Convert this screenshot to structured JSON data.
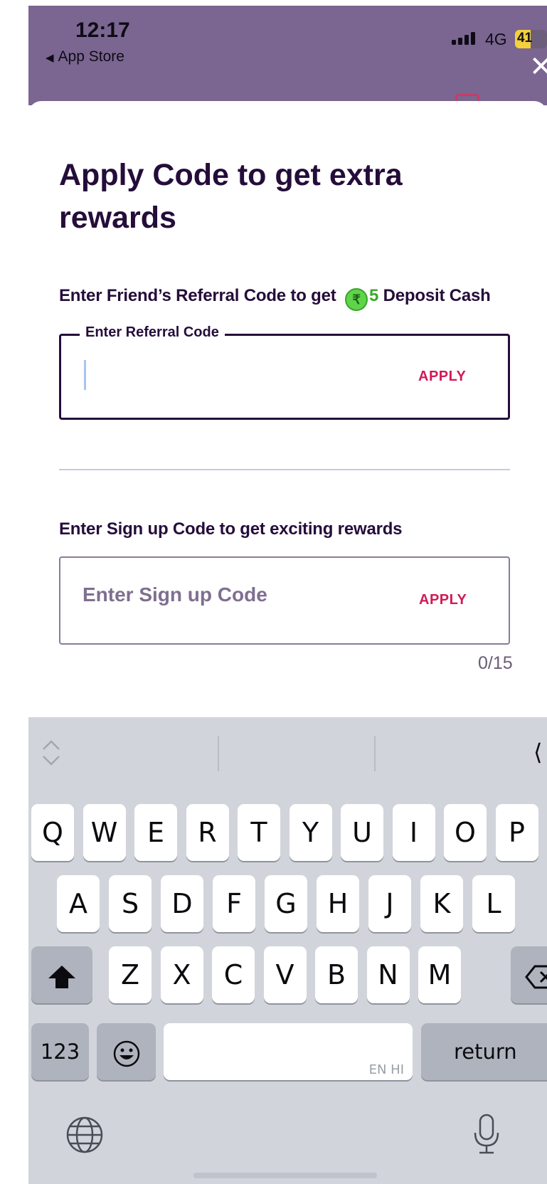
{
  "status_bar": {
    "time": "12:17",
    "back_app": "App Store",
    "network": "4G",
    "battery": "41"
  },
  "sheet": {
    "title": "Apply Code to get extra rewards",
    "close_icon": "close-icon",
    "referral": {
      "label_prefix": "Enter Friend’s Referral Code to get",
      "currency_icon": "₹",
      "amount": "5",
      "label_suffix": "Deposit Cash",
      "field_legend": "Enter Referral Code",
      "value": "",
      "apply_label": "APPLY"
    },
    "signup": {
      "label": "Enter Sign up Code to get exciting rewards",
      "placeholder": "Enter Sign up Code",
      "apply_label": "APPLY",
      "counter": "0/15"
    }
  },
  "keyboard": {
    "row1": [
      "Q",
      "W",
      "E",
      "R",
      "T",
      "Y",
      "U",
      "I",
      "O",
      "P"
    ],
    "row2": [
      "A",
      "S",
      "D",
      "F",
      "G",
      "H",
      "J",
      "K",
      "L"
    ],
    "row3": [
      "Z",
      "X",
      "C",
      "V",
      "B",
      "N",
      "M"
    ],
    "numbers_key": "123",
    "return_key": "return",
    "space_hint": "EN HI",
    "emoji_icon": "😃"
  },
  "colors": {
    "header_purple": "#7a6690",
    "text_dark": "#250d3a",
    "accent_red": "#d11a55",
    "reward_green": "#3aaa2c",
    "keyboard_bg": "#d1d4db"
  }
}
